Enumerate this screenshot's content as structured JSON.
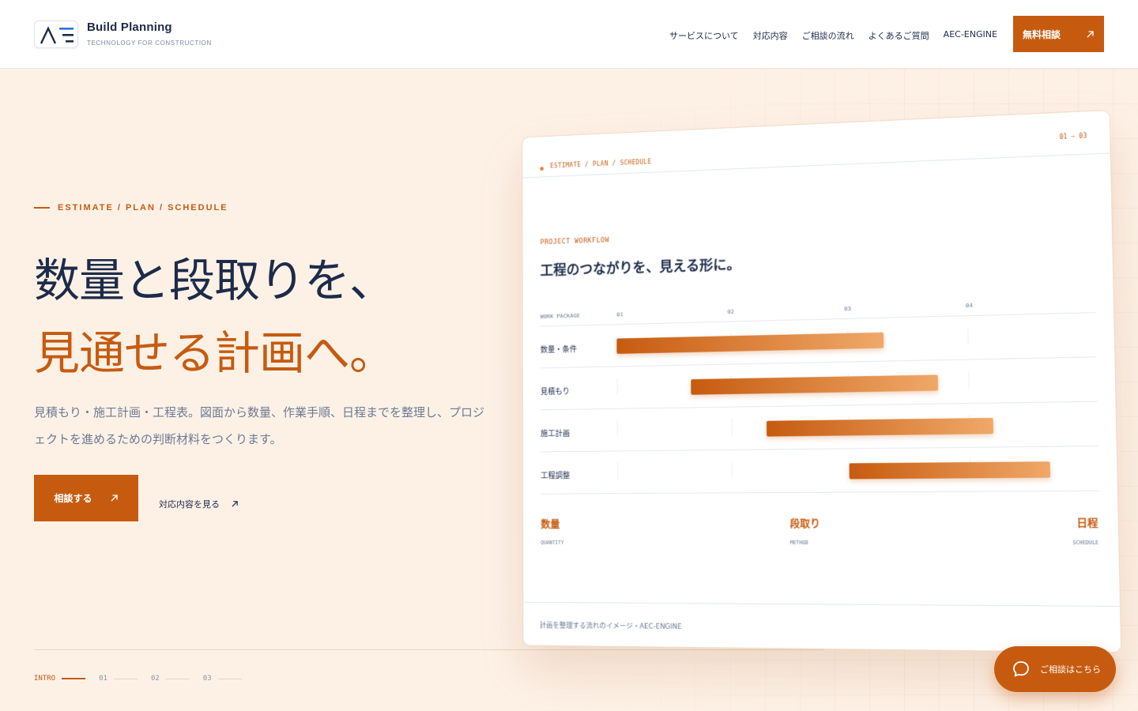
{
  "brand": {
    "name": "Build Planning",
    "tagline": "TECHNOLOGY FOR CONSTRUCTION"
  },
  "nav": {
    "items": [
      {
        "label": "サービスについて"
      },
      {
        "label": "対応内容"
      },
      {
        "label": "ご相談の流れ"
      },
      {
        "label": "よくあるご質問"
      },
      {
        "label": "AEC-ENGINE"
      }
    ],
    "cta_label": "無料相談"
  },
  "hero": {
    "eyebrow": "ESTIMATE / PLAN / SCHEDULE",
    "title_line1": "数量と段取りを、",
    "title_line2": "見通せる計画へ。",
    "description": "見積もり・施工計画・工程表。図面から数量、作業手順、日程までを整理し、プロジェクトを進めるための判断材料をつくります。",
    "primary_button": "相談する",
    "secondary_link": "対応内容を見る"
  },
  "progress": {
    "steps": [
      {
        "label": "INTRO"
      },
      {
        "label": "01"
      },
      {
        "label": "02"
      },
      {
        "label": "03"
      }
    ]
  },
  "card": {
    "breadcrumb": "ESTIMATE / PLAN / SCHEDULE",
    "counter": "01 — 03",
    "eyebrow": "PROJECT WORKFLOW",
    "title": "工程のつながりを、見える形に。",
    "gantt": {
      "column_header": "WORK PACKAGE",
      "periods": [
        "01",
        "02",
        "03",
        "04"
      ],
      "rows": [
        {
          "label": "数量・条件",
          "start": 0.0,
          "end": 2.3
        },
        {
          "label": "見積もり",
          "start": 0.65,
          "end": 2.75
        },
        {
          "label": "施工計画",
          "start": 1.3,
          "end": 3.2
        },
        {
          "label": "工程調整",
          "start": 2.0,
          "end": 3.65
        }
      ]
    },
    "metrics": [
      {
        "label": "数量",
        "sub": "QUANTITY"
      },
      {
        "label": "段取り",
        "sub": "METHOD"
      },
      {
        "label": "日程",
        "sub": "SCHEDULE"
      }
    ],
    "footer": "計画を整理する流れのイメージ・AEC-ENGINE"
  },
  "chat": {
    "label": "ご相談はこちら"
  },
  "colors": {
    "accent": "#c65b10",
    "navy": "#1c2b4a",
    "background": "#fdf1e6"
  }
}
